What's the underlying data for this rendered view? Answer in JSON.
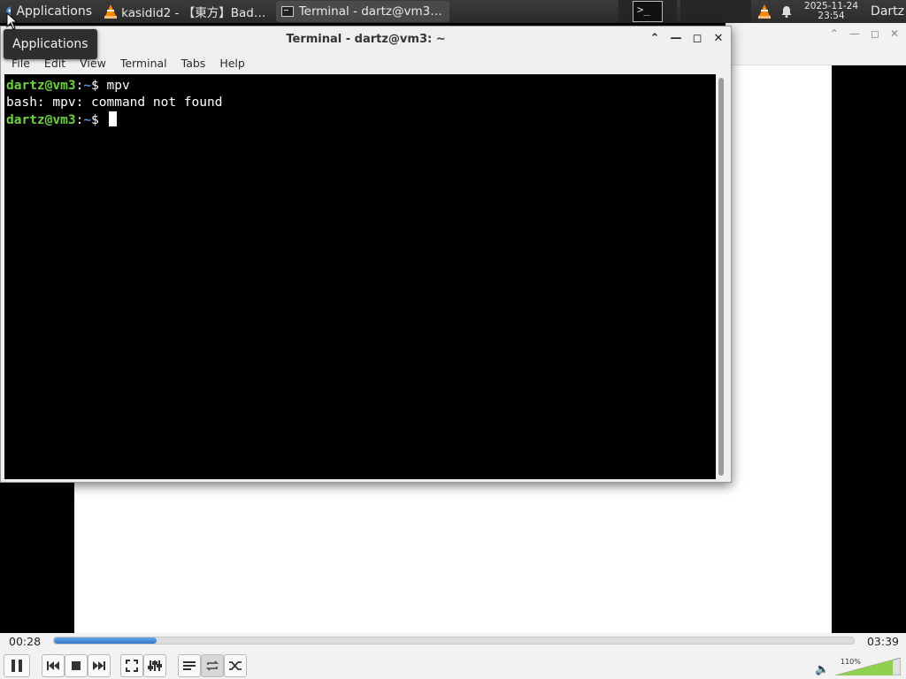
{
  "panel": {
    "applications_label": "Applications",
    "tasks": [
      {
        "label": "kasidid2 - 【東方】Bad A...",
        "icon": "vlc-cone-icon"
      },
      {
        "label": "Terminal - dartz@vm3: ~",
        "icon": "terminal-icon"
      }
    ],
    "clock": {
      "date": "2025-11-24",
      "time": "23:54"
    },
    "user": "Dartz"
  },
  "tooltip": {
    "text": "Applications"
  },
  "terminal": {
    "title": "Terminal - dartz@vm3: ~",
    "menu": [
      "File",
      "Edit",
      "View",
      "Terminal",
      "Tabs",
      "Help"
    ],
    "lines": [
      {
        "user": "dartz@vm3",
        "sep": ":",
        "path": "~",
        "dollar": "$ ",
        "cmd": "mpv"
      },
      {
        "output": "bash: mpv: command not found"
      },
      {
        "user": "dartz@vm3",
        "sep": ":",
        "path": "~",
        "dollar": "$ ",
        "cmd": ""
      }
    ]
  },
  "vlc": {
    "time_current": "00:28",
    "time_total": "03:39",
    "progress": 0.128,
    "volume_label": "110%",
    "volume": 1.1,
    "colors": {
      "seek_fill": "#2f78c8",
      "volume_fill": "#8fd14f"
    }
  }
}
